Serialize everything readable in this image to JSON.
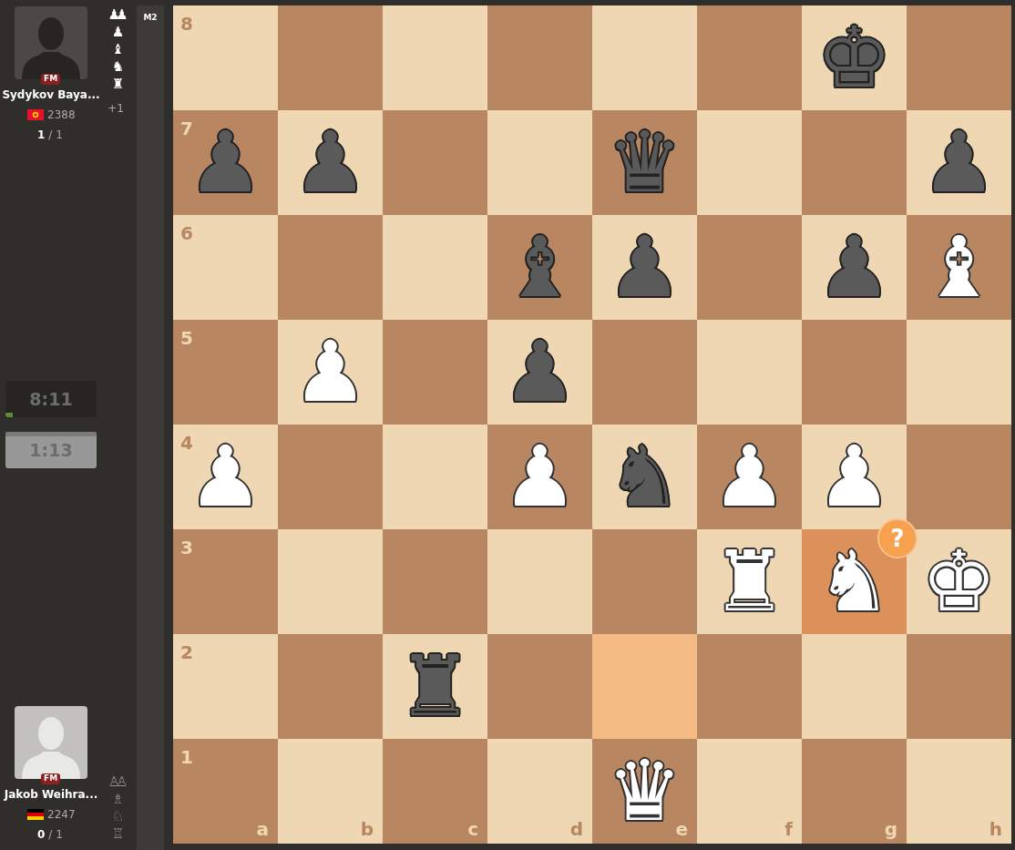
{
  "players": [
    {
      "title": "FM",
      "name": "Sydykov Baya...",
      "flag": {
        "kind": "kyrgyzstan"
      },
      "rating": "2388",
      "score": "1",
      "games": "/ 1",
      "dark_avatar": true,
      "captured": [
        "♟♟",
        "♟",
        "♝",
        "♞",
        "♜"
      ],
      "captured_dimmed": false,
      "advantage": "+1"
    },
    {
      "title": "FM",
      "name": "Jakob Weihra...",
      "flag": {
        "kind": "germany"
      },
      "rating": "2247",
      "score": "0",
      "games": "/ 1",
      "dark_avatar": false,
      "captured": [
        "♙♙",
        "♗",
        "♘",
        "♖"
      ],
      "captured_dimmed": true
    }
  ],
  "clocks": [
    {
      "time": "8:11",
      "active": false,
      "level": 0.08
    },
    {
      "time": "1:13",
      "active": true,
      "level": 0.01
    }
  ],
  "move_badge": "M2",
  "board": {
    "files": [
      "a",
      "b",
      "c",
      "d",
      "e",
      "f",
      "g",
      "h"
    ],
    "ranks": [
      {
        "label": "8",
        "squares": [
          {
            "dark": false
          },
          {
            "dark": true
          },
          {
            "dark": false
          },
          {
            "dark": true
          },
          {
            "dark": false
          },
          {
            "dark": true
          },
          {
            "dark": false,
            "piece": {
              "glyph": "♚",
              "white": false
            }
          },
          {
            "dark": true
          }
        ]
      },
      {
        "label": "7",
        "squares": [
          {
            "dark": true,
            "piece": {
              "glyph": "♟",
              "white": false
            }
          },
          {
            "dark": false,
            "piece": {
              "glyph": "♟",
              "white": false
            }
          },
          {
            "dark": true
          },
          {
            "dark": false
          },
          {
            "dark": true,
            "piece": {
              "glyph": "♛",
              "white": false
            }
          },
          {
            "dark": false
          },
          {
            "dark": true
          },
          {
            "dark": false,
            "piece": {
              "glyph": "♟",
              "white": false
            }
          }
        ]
      },
      {
        "label": "6",
        "squares": [
          {
            "dark": false
          },
          {
            "dark": true
          },
          {
            "dark": false
          },
          {
            "dark": true,
            "piece": {
              "glyph": "♝",
              "white": false
            }
          },
          {
            "dark": false,
            "piece": {
              "glyph": "♟",
              "white": false
            }
          },
          {
            "dark": true
          },
          {
            "dark": false,
            "piece": {
              "glyph": "♟",
              "white": false
            }
          },
          {
            "dark": true,
            "piece": {
              "glyph": "♝",
              "white": true
            }
          }
        ]
      },
      {
        "label": "5",
        "squares": [
          {
            "dark": true
          },
          {
            "dark": false,
            "piece": {
              "glyph": "♟",
              "white": true
            }
          },
          {
            "dark": true
          },
          {
            "dark": false,
            "piece": {
              "glyph": "♟",
              "white": false
            }
          },
          {
            "dark": true
          },
          {
            "dark": false
          },
          {
            "dark": true
          },
          {
            "dark": false
          }
        ]
      },
      {
        "label": "4",
        "squares": [
          {
            "dark": false,
            "piece": {
              "glyph": "♟",
              "white": true
            }
          },
          {
            "dark": true
          },
          {
            "dark": false
          },
          {
            "dark": true,
            "piece": {
              "glyph": "♟",
              "white": true
            }
          },
          {
            "dark": false,
            "piece": {
              "glyph": "♞",
              "white": false
            }
          },
          {
            "dark": true,
            "piece": {
              "glyph": "♟",
              "white": true
            }
          },
          {
            "dark": false,
            "piece": {
              "glyph": "♟",
              "white": true
            }
          },
          {
            "dark": true
          }
        ]
      },
      {
        "label": "3",
        "squares": [
          {
            "dark": true
          },
          {
            "dark": false
          },
          {
            "dark": true
          },
          {
            "dark": false
          },
          {
            "dark": true
          },
          {
            "dark": false,
            "piece": {
              "glyph": "♜",
              "white": true
            }
          },
          {
            "piece": {
              "glyph": "♞",
              "white": true
            },
            "moved_to": true,
            "annotation": "?"
          },
          {
            "dark": false,
            "piece": {
              "glyph": "♚",
              "white": true
            }
          }
        ]
      },
      {
        "label": "2",
        "squares": [
          {
            "dark": false
          },
          {
            "dark": true
          },
          {
            "dark": false,
            "piece": {
              "glyph": "♜",
              "white": false
            }
          },
          {
            "dark": true
          },
          {
            "moved_from": true
          },
          {
            "dark": true
          },
          {
            "dark": false
          },
          {
            "dark": true
          }
        ]
      },
      {
        "label": "1",
        "squares": [
          {
            "dark": true
          },
          {
            "dark": false
          },
          {
            "dark": true
          },
          {
            "dark": false
          },
          {
            "dark": true,
            "piece": {
              "glyph": "♛",
              "white": true
            }
          },
          {
            "dark": false
          },
          {
            "dark": true
          },
          {
            "dark": false
          }
        ]
      }
    ]
  }
}
